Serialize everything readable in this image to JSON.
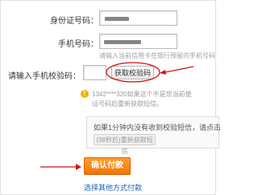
{
  "form": {
    "id_number": {
      "label": "身份证号码："
    },
    "phone": {
      "label": "手机号码：",
      "hint": "请输入当前信用卡在银行预留的手机号码"
    },
    "sms_code": {
      "label": "请输入手机校验码：",
      "value": "",
      "get_code_label": "获取校验码"
    },
    "notice": {
      "line1": "1342****320如果这个不是您当前使",
      "line2": "话号码后重新获取短信。"
    },
    "resend_panel": {
      "text": "如果1分钟内没有收到校验短信，请点击",
      "button_label": "(38秒后)重新获取短信"
    },
    "submit_label": "确认付款",
    "other_method_link": "选择其他方式付款"
  },
  "colors": {
    "primary_button": "#f27205",
    "link": "#1a5fb4",
    "annotation_red": "#d01010"
  },
  "icons": [
    "warning-icon"
  ]
}
